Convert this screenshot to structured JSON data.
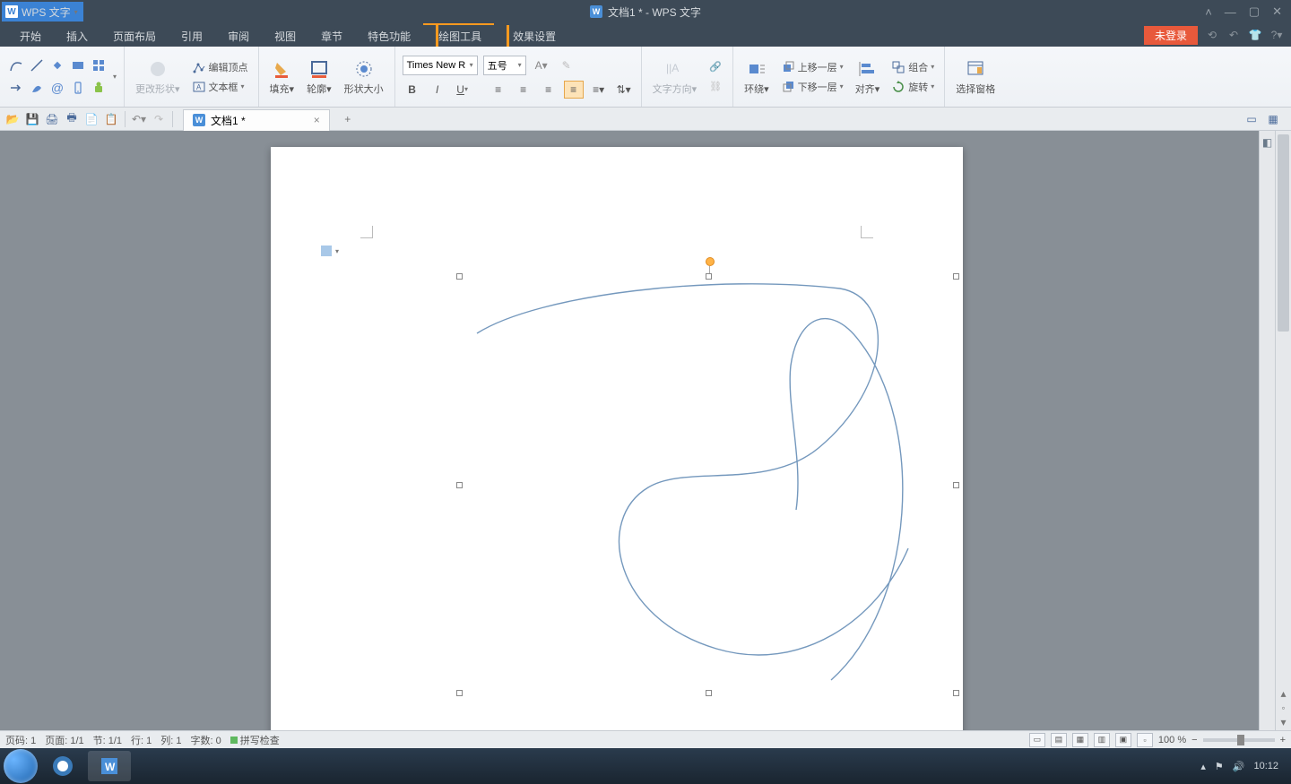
{
  "app": {
    "name": "WPS 文字",
    "doc_title": "文档1 * - WPS 文字"
  },
  "window_controls": {
    "min": "—",
    "max": "▢",
    "close": "✕",
    "up": "˄"
  },
  "menus": [
    "开始",
    "插入",
    "页面布局",
    "引用",
    "审阅",
    "视图",
    "章节",
    "特色功能",
    "绘图工具",
    "效果设置"
  ],
  "login_label": "未登录",
  "ribbon": {
    "change_shape": "更改形状",
    "edit_points": "编辑顶点",
    "text_box": "文本框",
    "fill": "填充",
    "outline": "轮廓",
    "shape_size": "形状大小",
    "font_name": "Times New R",
    "font_size": "五号",
    "text_direction": "文字方向",
    "wrap": "环绕",
    "bring_forward": "上移一层",
    "send_backward": "下移一层",
    "align": "对齐",
    "rotate": "旋转",
    "group": "组合",
    "select_pane": "选择窗格"
  },
  "tab": {
    "name": "文档1 *"
  },
  "status": {
    "page_num": "页码: 1",
    "page": "页面: 1/1",
    "section": "节: 1/1",
    "line": "行: 1",
    "col": "列: 1",
    "chars": "字数: 0",
    "spell": "拼写检查",
    "zoom": "100 %"
  },
  "clock": "10:12"
}
